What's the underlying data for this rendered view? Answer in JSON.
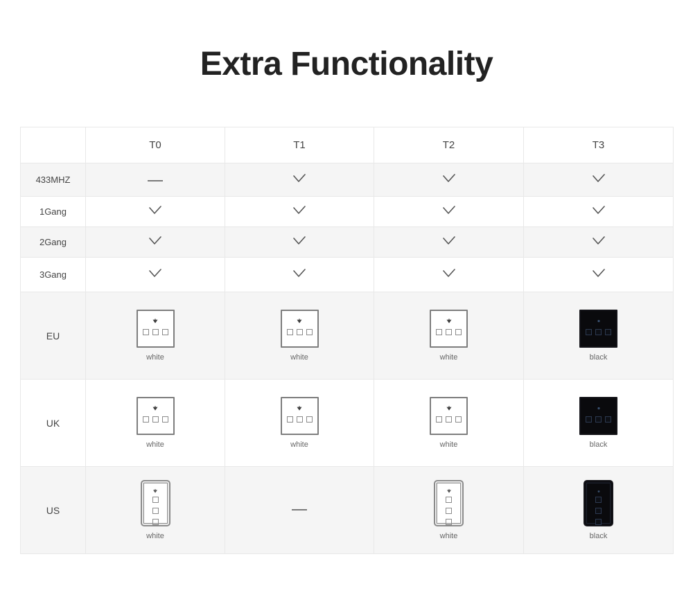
{
  "page": {
    "title": "Extra Functionality",
    "background": "#ffffff"
  },
  "colors": {
    "title_text": "#222222",
    "body_text": "#444444",
    "grid_line": "#e8e8e8",
    "stripe_row": "#f5f5f5",
    "plain_row": "#ffffff",
    "check_mark": "#555555",
    "panel_white_border": "#7d7d7d",
    "panel_black_fill": "#0a0a0d",
    "panel_black_button": "#2c3950"
  },
  "table": {
    "columns": [
      {
        "key": "label",
        "label": ""
      },
      {
        "key": "t0",
        "label": "T0"
      },
      {
        "key": "t1",
        "label": "T1"
      },
      {
        "key": "t2",
        "label": "T2"
      },
      {
        "key": "t3",
        "label": "T3"
      }
    ],
    "feature_rows": [
      {
        "label": "433MHZ",
        "t0": "dash",
        "t1": "check",
        "t2": "check",
        "t3": "check",
        "stripe": true
      },
      {
        "label": "1Gang",
        "t0": "check",
        "t1": "check",
        "t2": "check",
        "t3": "check",
        "stripe": false
      },
      {
        "label": "2Gang",
        "t0": "check",
        "t1": "check",
        "t2": "check",
        "t3": "check",
        "stripe": true
      },
      {
        "label": "3Gang",
        "t0": "check",
        "t1": "check",
        "t2": "check",
        "t3": "check",
        "stripe": false
      }
    ],
    "product_rows": [
      {
        "label": "EU",
        "stripe": true,
        "cells": [
          {
            "type": "panel",
            "form": "square",
            "color": "white",
            "caption": "white",
            "buttons": 3
          },
          {
            "type": "panel",
            "form": "square",
            "color": "white",
            "caption": "white",
            "buttons": 3
          },
          {
            "type": "panel",
            "form": "square",
            "color": "white",
            "caption": "white",
            "buttons": 3
          },
          {
            "type": "panel",
            "form": "square",
            "color": "black",
            "caption": "black",
            "buttons": 3
          }
        ]
      },
      {
        "label": "UK",
        "stripe": false,
        "cells": [
          {
            "type": "panel",
            "form": "square",
            "color": "white",
            "caption": "white",
            "buttons": 3
          },
          {
            "type": "panel",
            "form": "square",
            "color": "white",
            "caption": "white",
            "buttons": 3
          },
          {
            "type": "panel",
            "form": "square",
            "color": "white",
            "caption": "white",
            "buttons": 3
          },
          {
            "type": "panel",
            "form": "square",
            "color": "black",
            "caption": "black",
            "buttons": 3
          }
        ]
      },
      {
        "label": "US",
        "stripe": true,
        "cells": [
          {
            "type": "panel",
            "form": "vertical",
            "color": "white",
            "caption": "white",
            "buttons": 3
          },
          {
            "type": "dash",
            "form": "",
            "color": "",
            "caption": "",
            "buttons": 0
          },
          {
            "type": "panel",
            "form": "vertical",
            "color": "white",
            "caption": "white",
            "buttons": 3
          },
          {
            "type": "panel",
            "form": "vertical",
            "color": "black",
            "caption": "black",
            "buttons": 3
          }
        ]
      }
    ]
  },
  "icons": {
    "check": "check-icon",
    "dash": "dash-icon",
    "logo": "brand-dot-icon"
  }
}
